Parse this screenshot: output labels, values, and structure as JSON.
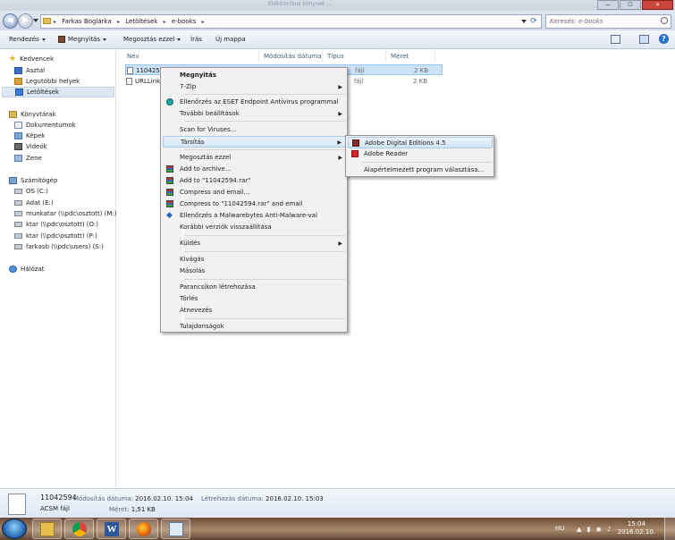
{
  "window": {
    "title_fragment": "Elektronikus könyvek ...",
    "controls": {
      "minimize": "—",
      "maximize": "☐",
      "close": "✕"
    }
  },
  "address": {
    "crumbs": [
      "Farkas Boglárka",
      "Letöltések",
      "e-books"
    ],
    "search_placeholder": "Keresés: e-books"
  },
  "toolbar": {
    "organize": "Rendezés",
    "open": "Megnyitás",
    "share": "Megosztás ezzel",
    "burn": "Írás",
    "new_folder": "Új mappa"
  },
  "sidebar": {
    "favorites": "Kedvencek",
    "desktop": "Asztal",
    "recent": "Legutóbbi helyek",
    "downloads": "Letöltések",
    "libraries": "Könyvtárak",
    "documents": "Dokumentumok",
    "pictures": "Képek",
    "videos": "Videók",
    "music": "Zene",
    "computer": "Számítógép",
    "drives": [
      "OS (C:)",
      "Adat (E:)",
      "munkatar (\\\\pdc\\osztott) (M:)",
      "ktar (\\\\pdc\\osztott) (O:)",
      "ktar (\\\\pdc\\osztott) (P:)",
      "farkasb (\\\\pdc\\users) (S:)"
    ],
    "network": "Hálózat"
  },
  "columns": {
    "name": "Név",
    "modified": "Módosítás dátuma",
    "type": "Típus",
    "size": "Méret"
  },
  "files": [
    {
      "name": "11042594",
      "type": "fájl",
      "size": "2 KB"
    },
    {
      "name": "URLLink",
      "type": "fájl",
      "size": "2 KB"
    }
  ],
  "context_menu": {
    "items": [
      "Megnyitás",
      "7-Zip",
      "Ellenőrzés az ESET Endpoint Antivirus programmal",
      "További beállítások",
      "Scan for Viruses...",
      "Társítás",
      "Megosztás ezzel",
      "Add to archive...",
      "Add to \"11042594.rar\"",
      "Compress and email...",
      "Compress to \"11042594.rar\" and email",
      "Ellenőrzés a Malwarebytes Anti-Malware-val",
      "Korábbi verziók visszaállítása",
      "Küldés",
      "Kivágás",
      "Másolás",
      "Parancsikon létrehozása",
      "Törlés",
      "Átnevezés",
      "Tulajdonságok"
    ]
  },
  "submenu": {
    "items": [
      "Adobe Digital Editions 4.5",
      "Adobe Reader",
      "Alapértelmezett program választása..."
    ]
  },
  "details": {
    "name": "11042594",
    "type": "ACSM fájl",
    "modified_label": "Módosítás dátuma:",
    "modified": "2016.02.10. 15:04",
    "created_label": "Létrehozás dátuma:",
    "created": "2016.02.10. 15:03",
    "size_label": "Méret:",
    "size": "1,51 KB"
  },
  "taskbar": {
    "lang": "HU",
    "time": "15:04",
    "date": "2016.02.10."
  }
}
